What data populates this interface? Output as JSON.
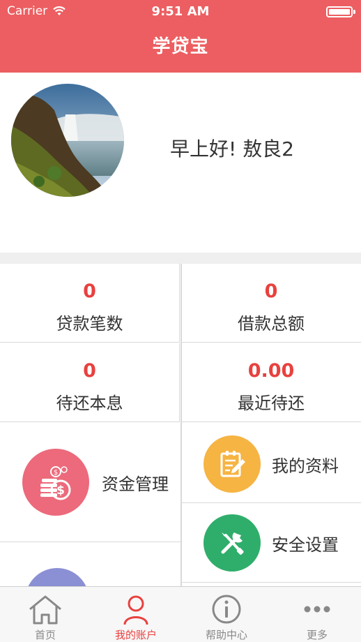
{
  "status_bar": {
    "carrier": "Carrier",
    "time": "9:51 AM"
  },
  "nav": {
    "title": "学贷宝"
  },
  "profile": {
    "greeting": "早上好!  敖良2"
  },
  "stats": [
    {
      "value": "0",
      "label": "贷款笔数"
    },
    {
      "value": "0",
      "label": "借款总额"
    },
    {
      "value": "0",
      "label": "待还本息"
    },
    {
      "value": "0.00",
      "label": "最近待还"
    }
  ],
  "menu": {
    "funds": {
      "label": "资金管理",
      "icon": "money-coins-icon",
      "color": "#ec6a7b"
    },
    "profile": {
      "label": "我的资料",
      "icon": "document-edit-icon",
      "color": "#f6b443"
    },
    "security": {
      "label": "安全设置",
      "icon": "tools-icon",
      "color": "#2fae6b"
    },
    "partial": {
      "color": "#8b8fd4"
    }
  },
  "tabbar": {
    "items": [
      {
        "label": "首页",
        "icon": "home-icon"
      },
      {
        "label": "我的账户",
        "icon": "person-icon"
      },
      {
        "label": "帮助中心",
        "icon": "info-icon"
      },
      {
        "label": "更多",
        "icon": "more-icon"
      }
    ],
    "active_index": 1
  },
  "colors": {
    "brand": "#ec5e61",
    "accent_number": "#e8413f"
  }
}
